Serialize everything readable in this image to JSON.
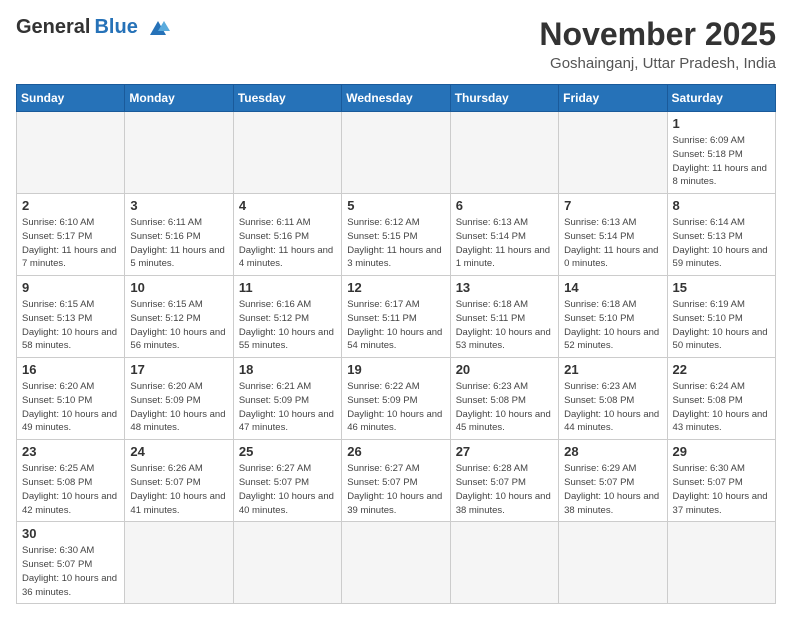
{
  "header": {
    "logo_general": "General",
    "logo_blue": "Blue",
    "month_title": "November 2025",
    "location": "Goshainganj, Uttar Pradesh, India"
  },
  "days_of_week": [
    "Sunday",
    "Monday",
    "Tuesday",
    "Wednesday",
    "Thursday",
    "Friday",
    "Saturday"
  ],
  "weeks": [
    [
      {
        "day": "",
        "info": ""
      },
      {
        "day": "",
        "info": ""
      },
      {
        "day": "",
        "info": ""
      },
      {
        "day": "",
        "info": ""
      },
      {
        "day": "",
        "info": ""
      },
      {
        "day": "",
        "info": ""
      },
      {
        "day": "1",
        "info": "Sunrise: 6:09 AM\nSunset: 5:18 PM\nDaylight: 11 hours\nand 8 minutes."
      }
    ],
    [
      {
        "day": "2",
        "info": "Sunrise: 6:10 AM\nSunset: 5:17 PM\nDaylight: 11 hours\nand 7 minutes."
      },
      {
        "day": "3",
        "info": "Sunrise: 6:11 AM\nSunset: 5:16 PM\nDaylight: 11 hours\nand 5 minutes."
      },
      {
        "day": "4",
        "info": "Sunrise: 6:11 AM\nSunset: 5:16 PM\nDaylight: 11 hours\nand 4 minutes."
      },
      {
        "day": "5",
        "info": "Sunrise: 6:12 AM\nSunset: 5:15 PM\nDaylight: 11 hours\nand 3 minutes."
      },
      {
        "day": "6",
        "info": "Sunrise: 6:13 AM\nSunset: 5:14 PM\nDaylight: 11 hours\nand 1 minute."
      },
      {
        "day": "7",
        "info": "Sunrise: 6:13 AM\nSunset: 5:14 PM\nDaylight: 11 hours\nand 0 minutes."
      },
      {
        "day": "8",
        "info": "Sunrise: 6:14 AM\nSunset: 5:13 PM\nDaylight: 10 hours\nand 59 minutes."
      }
    ],
    [
      {
        "day": "9",
        "info": "Sunrise: 6:15 AM\nSunset: 5:13 PM\nDaylight: 10 hours\nand 58 minutes."
      },
      {
        "day": "10",
        "info": "Sunrise: 6:15 AM\nSunset: 5:12 PM\nDaylight: 10 hours\nand 56 minutes."
      },
      {
        "day": "11",
        "info": "Sunrise: 6:16 AM\nSunset: 5:12 PM\nDaylight: 10 hours\nand 55 minutes."
      },
      {
        "day": "12",
        "info": "Sunrise: 6:17 AM\nSunset: 5:11 PM\nDaylight: 10 hours\nand 54 minutes."
      },
      {
        "day": "13",
        "info": "Sunrise: 6:18 AM\nSunset: 5:11 PM\nDaylight: 10 hours\nand 53 minutes."
      },
      {
        "day": "14",
        "info": "Sunrise: 6:18 AM\nSunset: 5:10 PM\nDaylight: 10 hours\nand 52 minutes."
      },
      {
        "day": "15",
        "info": "Sunrise: 6:19 AM\nSunset: 5:10 PM\nDaylight: 10 hours\nand 50 minutes."
      }
    ],
    [
      {
        "day": "16",
        "info": "Sunrise: 6:20 AM\nSunset: 5:10 PM\nDaylight: 10 hours\nand 49 minutes."
      },
      {
        "day": "17",
        "info": "Sunrise: 6:20 AM\nSunset: 5:09 PM\nDaylight: 10 hours\nand 48 minutes."
      },
      {
        "day": "18",
        "info": "Sunrise: 6:21 AM\nSunset: 5:09 PM\nDaylight: 10 hours\nand 47 minutes."
      },
      {
        "day": "19",
        "info": "Sunrise: 6:22 AM\nSunset: 5:09 PM\nDaylight: 10 hours\nand 46 minutes."
      },
      {
        "day": "20",
        "info": "Sunrise: 6:23 AM\nSunset: 5:08 PM\nDaylight: 10 hours\nand 45 minutes."
      },
      {
        "day": "21",
        "info": "Sunrise: 6:23 AM\nSunset: 5:08 PM\nDaylight: 10 hours\nand 44 minutes."
      },
      {
        "day": "22",
        "info": "Sunrise: 6:24 AM\nSunset: 5:08 PM\nDaylight: 10 hours\nand 43 minutes."
      }
    ],
    [
      {
        "day": "23",
        "info": "Sunrise: 6:25 AM\nSunset: 5:08 PM\nDaylight: 10 hours\nand 42 minutes."
      },
      {
        "day": "24",
        "info": "Sunrise: 6:26 AM\nSunset: 5:07 PM\nDaylight: 10 hours\nand 41 minutes."
      },
      {
        "day": "25",
        "info": "Sunrise: 6:27 AM\nSunset: 5:07 PM\nDaylight: 10 hours\nand 40 minutes."
      },
      {
        "day": "26",
        "info": "Sunrise: 6:27 AM\nSunset: 5:07 PM\nDaylight: 10 hours\nand 39 minutes."
      },
      {
        "day": "27",
        "info": "Sunrise: 6:28 AM\nSunset: 5:07 PM\nDaylight: 10 hours\nand 38 minutes."
      },
      {
        "day": "28",
        "info": "Sunrise: 6:29 AM\nSunset: 5:07 PM\nDaylight: 10 hours\nand 38 minutes."
      },
      {
        "day": "29",
        "info": "Sunrise: 6:30 AM\nSunset: 5:07 PM\nDaylight: 10 hours\nand 37 minutes."
      }
    ],
    [
      {
        "day": "30",
        "info": "Sunrise: 6:30 AM\nSunset: 5:07 PM\nDaylight: 10 hours\nand 36 minutes."
      },
      {
        "day": "",
        "info": ""
      },
      {
        "day": "",
        "info": ""
      },
      {
        "day": "",
        "info": ""
      },
      {
        "day": "",
        "info": ""
      },
      {
        "day": "",
        "info": ""
      },
      {
        "day": "",
        "info": ""
      }
    ]
  ]
}
